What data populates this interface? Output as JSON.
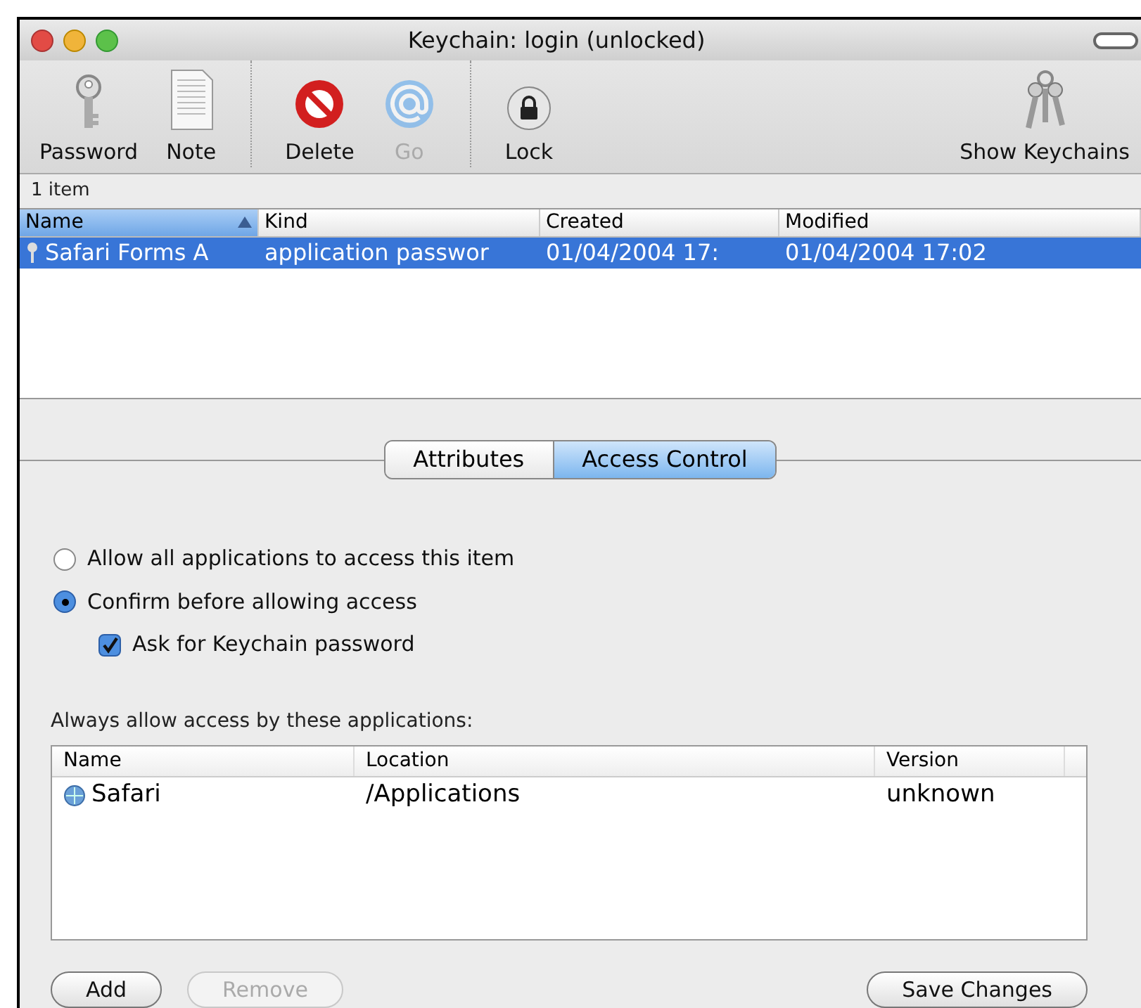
{
  "window": {
    "title": "Keychain: login (unlocked)"
  },
  "toolbar": {
    "groups": [
      [
        {
          "label": "Password",
          "disabled": false
        },
        {
          "label": "Note",
          "disabled": false
        }
      ],
      [
        {
          "label": "Delete",
          "disabled": false
        },
        {
          "label": "Go",
          "disabled": true
        }
      ],
      [
        {
          "label": "Lock",
          "disabled": false
        }
      ]
    ],
    "right": {
      "label": "Show Keychains",
      "disabled": false
    }
  },
  "item_count": "1 item",
  "table": {
    "columns": [
      {
        "label": "Name",
        "selected": true
      },
      {
        "label": "Kind",
        "selected": false
      },
      {
        "label": "Created",
        "selected": false
      },
      {
        "label": "Modified",
        "selected": false
      }
    ],
    "rows": [
      {
        "selected": true,
        "cells": [
          "Safari Forms A",
          "application passwor",
          "01/04/2004 17:",
          "01/04/2004 17:02"
        ]
      }
    ]
  },
  "tabs": [
    {
      "label": "Attributes",
      "selected": false
    },
    {
      "label": "Access Control",
      "selected": true
    }
  ],
  "options": [
    {
      "kind": "radio",
      "label": "Allow all applications to access this item",
      "checked": false
    },
    {
      "kind": "radio",
      "label": "Confirm before allowing access",
      "checked": true
    },
    {
      "kind": "checkbox",
      "label": "Ask for Keychain password",
      "checked": true
    }
  ],
  "apps": {
    "label": "Always allow access by these applications:",
    "columns": [
      "Name",
      "Location",
      "Version"
    ],
    "rows": [
      [
        "Safari",
        "/Applications",
        "unknown"
      ]
    ]
  },
  "buttons": [
    {
      "label": "Add",
      "disabled": false
    },
    {
      "label": "Remove",
      "disabled": true
    },
    {
      "label": "Save Changes",
      "disabled": false
    }
  ]
}
